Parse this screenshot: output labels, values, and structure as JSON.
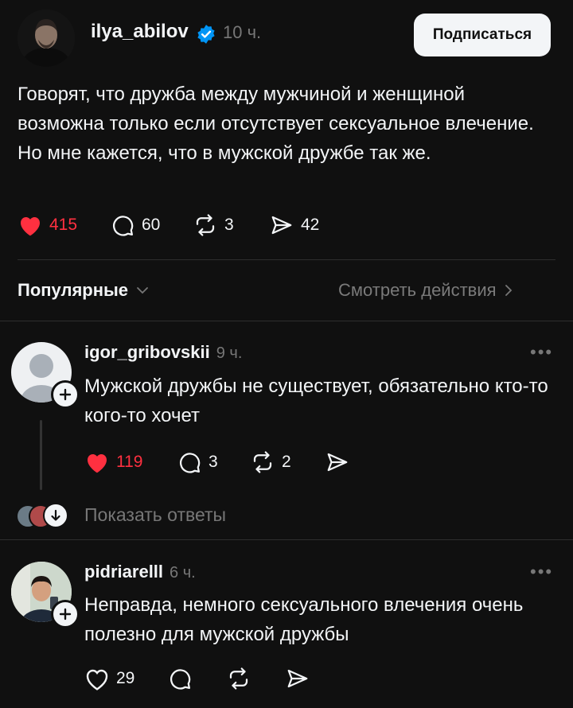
{
  "post": {
    "username": "ilya_abilov",
    "time": "10 ч.",
    "follow_label": "Подписаться",
    "text": "Говорят, что дружба между мужчиной и женщиной возможна только если отсутствует сексуальное влечение. Но мне кажется, что в мужской дружбе так же.",
    "likes": "415",
    "comments": "60",
    "reposts": "3",
    "shares": "42",
    "liked": true
  },
  "replies_header": {
    "sort_label": "Популярные",
    "activity_label": "Смотреть действия"
  },
  "comments": [
    {
      "username": "igor_gribovskii",
      "time": "9 ч.",
      "text": "Мужской дружбы не существует, обязательно кто-то кого-то хочет",
      "likes": "119",
      "comments": "3",
      "reposts": "2",
      "liked": true,
      "show_replies_label": "Показать ответы"
    },
    {
      "username": "pidriarelll",
      "time": "6 ч.",
      "text": "Неправда, немного сексуального влечения очень полезно для мужской дружбы",
      "likes": "29",
      "liked": false
    }
  ],
  "colors": {
    "background": "#101010",
    "text": "#f3f5f7",
    "muted": "#777777",
    "like_red": "#ff3040",
    "verified_blue": "#0095f6"
  },
  "icons": [
    "verified-badge-icon",
    "heart-icon",
    "comment-icon",
    "repost-icon",
    "share-icon",
    "chevron-down-icon",
    "chevron-right-icon",
    "more-icon",
    "plus-icon",
    "arrow-down-icon"
  ]
}
